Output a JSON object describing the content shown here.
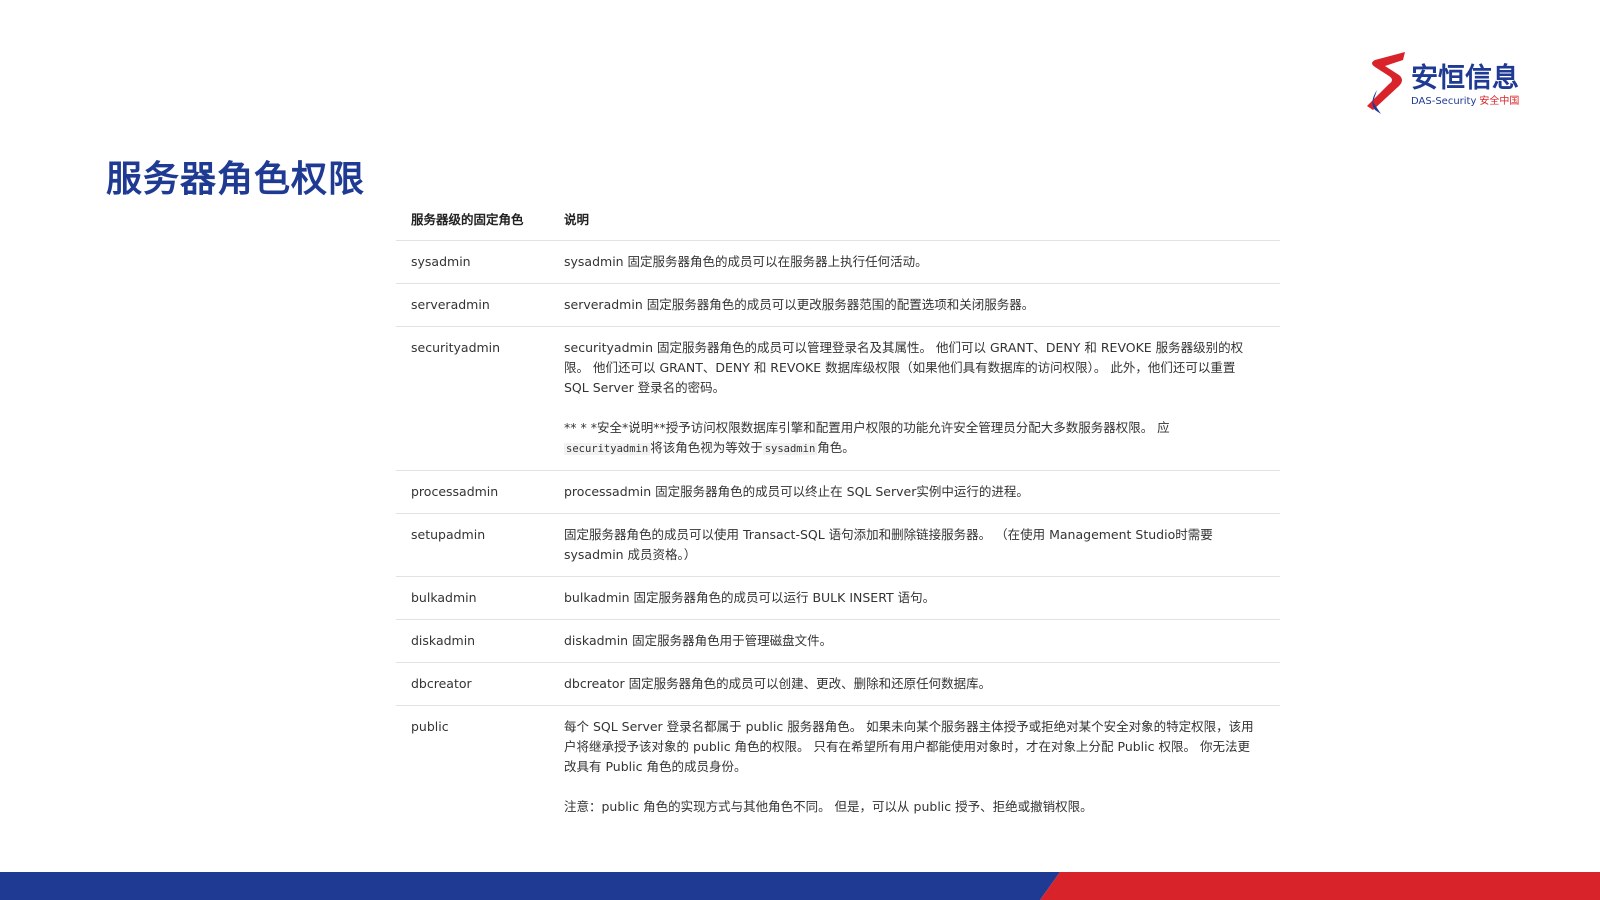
{
  "title": "服务器角色权限",
  "logo": {
    "name": "安恒信息",
    "sub_en": "DAS-Security",
    "sub_cn": "安全中国"
  },
  "table": {
    "headers": [
      "服务器级的固定角色",
      "说明"
    ],
    "rows": [
      {
        "role": "sysadmin",
        "desc": [
          "sysadmin 固定服务器角色的成员可以在服务器上执行任何活动。"
        ]
      },
      {
        "role": "serveradmin",
        "desc": [
          "serveradmin 固定服务器角色的成员可以更改服务器范围的配置选项和关闭服务器。"
        ]
      },
      {
        "role": "securityadmin",
        "desc": [
          "securityadmin 固定服务器角色的成员可以管理登录名及其属性。 他们可以 GRANT、DENY 和 REVOKE 服务器级别的权限。 他们还可以 GRANT、DENY 和 REVOKE 数据库级权限（如果他们具有数据库的访问权限）。 此外，他们还可以重置 SQL Server 登录名的密码。"
        ],
        "note": {
          "prefix": "** * *安全*说明**授予访问权限数据库引擎和配置用户权限的功能允许安全管理员分配大多数服务器权限。 应 ",
          "code1": "securityadmin",
          "mid": "将该角色视为等效于",
          "code2": "sysadmin",
          "suffix": "角色。"
        }
      },
      {
        "role": "processadmin",
        "desc": [
          "processadmin 固定服务器角色的成员可以终止在 SQL Server实例中运行的进程。"
        ]
      },
      {
        "role": "setupadmin",
        "desc": [
          "固定服务器角色的成员可以使用 Transact-SQL 语句添加和删除链接服务器。 （在使用 Management Studio时需要 sysadmin 成员资格。）"
        ]
      },
      {
        "role": "bulkadmin",
        "desc": [
          "bulkadmin 固定服务器角色的成员可以运行 BULK INSERT 语句。"
        ]
      },
      {
        "role": "diskadmin",
        "desc": [
          "diskadmin 固定服务器角色用于管理磁盘文件。"
        ]
      },
      {
        "role": "dbcreator",
        "desc": [
          "dbcreator 固定服务器角色的成员可以创建、更改、删除和还原任何数据库。"
        ]
      },
      {
        "role": "public",
        "desc": [
          "每个 SQL Server 登录名都属于 public 服务器角色。 如果未向某个服务器主体授予或拒绝对某个安全对象的特定权限，该用户将继承授予该对象的 public 角色的权限。 只有在希望所有用户都能使用对象时，才在对象上分配 Public 权限。 你无法更改具有 Public 角色的成员身份。",
          "注意：public 角色的实现方式与其他角色不同。 但是，可以从 public 授予、拒绝或撤销权限。"
        ]
      }
    ]
  },
  "colors": {
    "title": "#1f3a93",
    "footer_blue": "#1f3a93",
    "footer_red": "#d8232a"
  }
}
